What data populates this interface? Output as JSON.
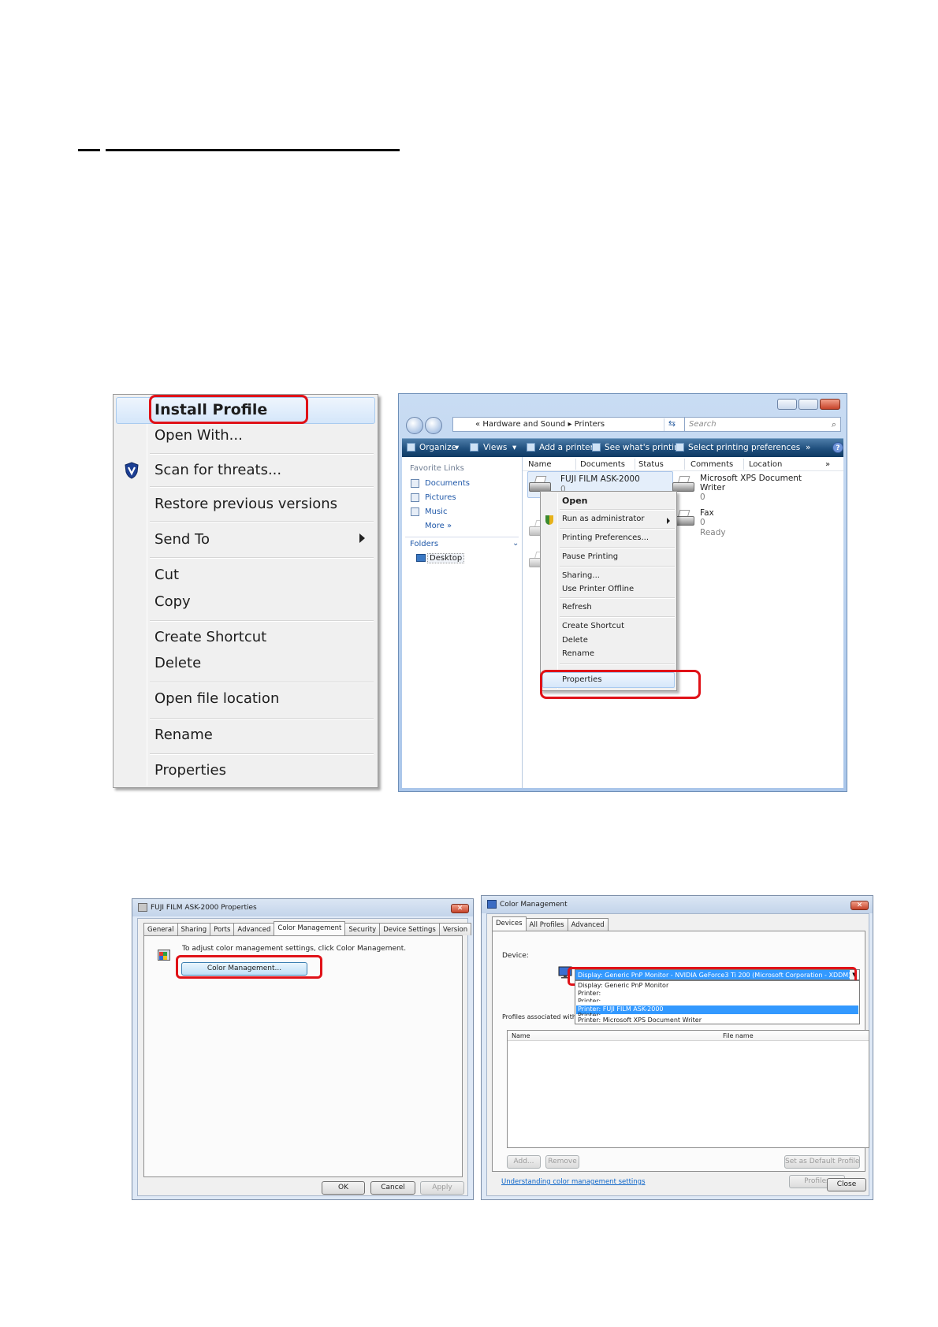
{
  "context_menu": {
    "items": [
      "Install Profile",
      "Open With...",
      "Scan for threats...",
      "Restore previous versions",
      "Send To",
      "Cut",
      "Copy",
      "Create Shortcut",
      "Delete",
      "Open file location",
      "Rename",
      "Properties"
    ]
  },
  "explorer": {
    "breadcrumb_prefix": "«",
    "breadcrumb": [
      "Hardware and Sound",
      "Printers"
    ],
    "search_placeholder": "Search",
    "toolbar": {
      "organize": "Organize",
      "views": "Views",
      "add_printer": "Add a printer",
      "see_printing": "See what's printing",
      "select_prefs": "Select printing preferences",
      "more": "»",
      "help": "?"
    },
    "favorite_links_header": "Favorite Links",
    "favorite_links": [
      "Documents",
      "Pictures",
      "Music"
    ],
    "more_link": "More  »",
    "folders_header": "Folders",
    "folders_item": "Desktop",
    "columns": [
      "Name",
      "Documents",
      "Status",
      "Comments",
      "Location",
      "»"
    ],
    "printers": [
      {
        "name": "FUJI FILM ASK-2000",
        "docs": "0"
      },
      {
        "name": "Microsoft XPS Document",
        "name2": "Writer",
        "docs": "0"
      },
      {
        "name": "Fax",
        "docs": "0",
        "status": "Ready"
      }
    ],
    "printer_menu": [
      "Open",
      "Run as administrator",
      "Printing Preferences...",
      "Pause Printing",
      "Sharing...",
      "Use Printer Offline",
      "Refresh",
      "Create Shortcut",
      "Delete",
      "Rename",
      "Properties"
    ]
  },
  "properties_dialog": {
    "title": "FUJI FILM ASK-2000 Properties",
    "close": "✕",
    "tabs": [
      "General",
      "Sharing",
      "Ports",
      "Advanced",
      "Color Management",
      "Security",
      "Device Settings",
      "Version"
    ],
    "active_tab": "Color Management",
    "instruction": "To adjust color management settings, click Color Management.",
    "color_management_button": "Color Management...",
    "buttons": {
      "ok": "OK",
      "cancel": "Cancel",
      "apply": "Apply"
    }
  },
  "color_management_dialog": {
    "title": "Color Management",
    "close": "✕",
    "tabs": [
      "Devices",
      "All Profiles",
      "Advanced"
    ],
    "active_tab": "Devices",
    "device_label": "Device:",
    "device_selected": "Display: Generic PnP Monitor - NVIDIA GeForce3 Ti 200 (Microsoft Corporation - XDDM)",
    "dropdown_options": [
      "Display: Generic PnP Monitor",
      "Printer:",
      "Printer:",
      "Printer: FUJI FILM ASK-2000",
      "Printer:",
      "Printer: Microsoft XPS Document Writer"
    ],
    "highlighted_option": "Printer: FUJI FILM ASK-2000",
    "profiles_label": "Profiles associated with th",
    "table_columns": [
      "Name",
      "File name"
    ],
    "buttons": {
      "add": "Add...",
      "remove": "Remove",
      "set_default": "Set as Default Profile",
      "profiles": "Profiles",
      "close": "Close"
    },
    "link": "Understanding color management settings"
  },
  "colors": {
    "highlight_red": "#e01218",
    "vista_toolbar": "#1f4f7d",
    "selection_blue": "#3399ff",
    "link_blue": "#1e57a8"
  }
}
